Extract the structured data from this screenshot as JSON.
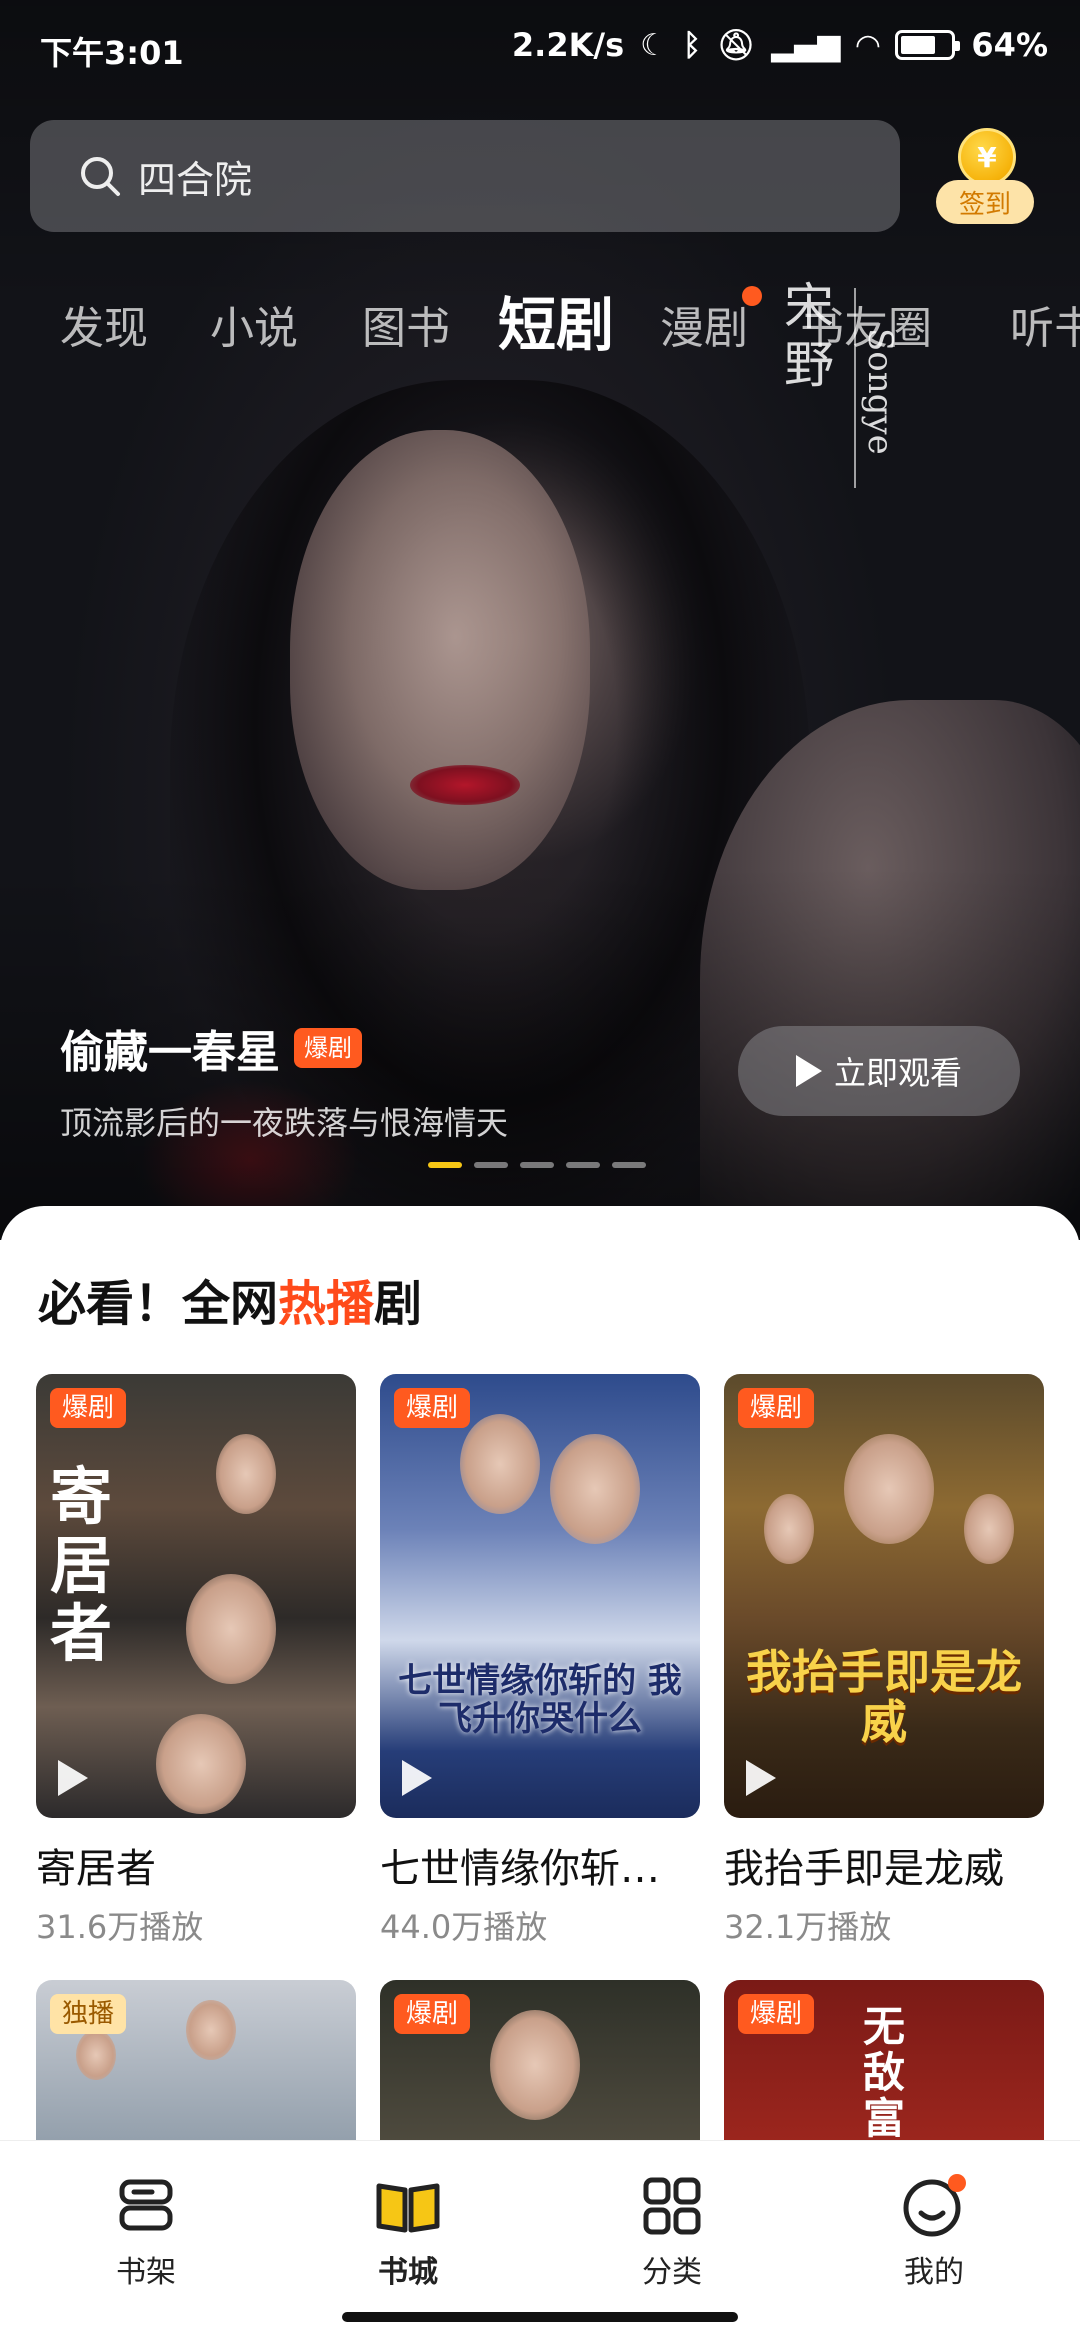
{
  "status_bar": {
    "time": "下午3:01",
    "net_speed": "2.2K/s",
    "battery": "64%"
  },
  "search": {
    "placeholder": "四合院"
  },
  "sign_in": {
    "coin_glyph": "¥",
    "label": "签到"
  },
  "tabs": [
    "发现",
    "小说",
    "图书",
    "短剧",
    "漫剧",
    "书友圈",
    "听书"
  ],
  "active_tab": "短剧",
  "watermark": {
    "cn": "宋野",
    "en": "Songye"
  },
  "hero": {
    "title": "偷藏一春星",
    "badge": "爆剧",
    "subtitle": "顶流影后的一夜跌落与恨海情天",
    "watch_button": "立即观看",
    "page_count": 5,
    "active_page": 1
  },
  "section": {
    "title_prefix": "必看！全网",
    "title_highlight": "热播",
    "title_suffix": "剧"
  },
  "dramas": [
    {
      "badge": "爆剧",
      "poster_text": "寄居者",
      "name": "寄居者",
      "plays": "31.6万播放"
    },
    {
      "badge": "爆剧",
      "poster_text": "七世情缘你斩的 我飞升你哭什么",
      "name": "七世情缘你斩…",
      "plays": "44.0万播放"
    },
    {
      "badge": "爆剧",
      "poster_text": "我抬手即是龙威",
      "name": "我抬手即是龙威",
      "plays": "32.1万播放"
    },
    {
      "badge": "独播"
    },
    {
      "badge": "爆剧"
    },
    {
      "badge": "爆剧",
      "poster_text": "无敌富"
    }
  ],
  "nav": [
    {
      "label": "书架",
      "icon": "bookshelf-icon"
    },
    {
      "label": "书城",
      "icon": "open-book-icon",
      "active": true
    },
    {
      "label": "分类",
      "icon": "grid-icon"
    },
    {
      "label": "我的",
      "icon": "smile-icon",
      "dot": true
    }
  ],
  "colors": {
    "accent_orange": "#ff5a1f",
    "accent_yellow": "#f6c615",
    "highlight_text": "#ff4a1a"
  }
}
